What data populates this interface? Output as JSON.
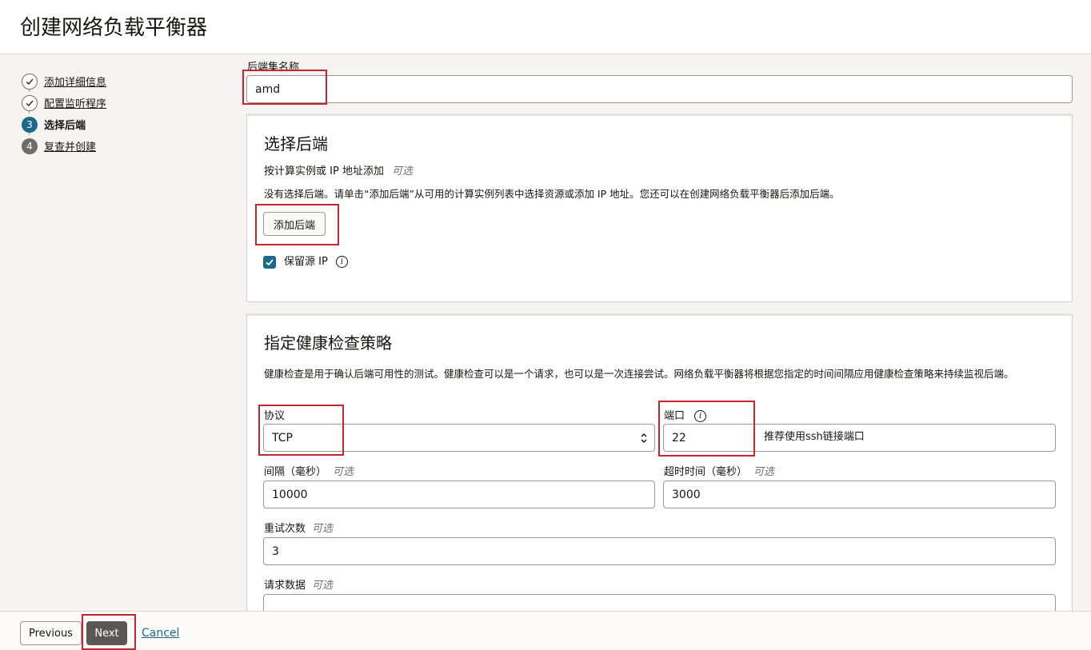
{
  "page": {
    "title": "创建网络负载平衡器"
  },
  "steps": [
    {
      "num": "1",
      "label": "添加详细信息",
      "state": "done"
    },
    {
      "num": "2",
      "label": "配置监听程序",
      "state": "done"
    },
    {
      "num": "3",
      "label": "选择后端",
      "state": "current"
    },
    {
      "num": "4",
      "label": "复查并创建",
      "state": "todo"
    }
  ],
  "backend_set": {
    "label": "后端集名称",
    "value": "amd"
  },
  "select_backends": {
    "title": "选择后端",
    "add_by_label": "按计算实例或 IP 地址添加",
    "optional": "可选",
    "empty_message": "没有选择后端。请单击“添加后端”从可用的计算实例列表中选择资源或添加 IP 地址。您还可以在创建网络负载平衡器后添加后端。",
    "add_button": "添加后端",
    "preserve_source_ip": {
      "label": "保留源 IP",
      "checked": true
    }
  },
  "health_check": {
    "title": "指定健康检查策略",
    "description": "健康检查是用于确认后端可用性的测试。健康检查可以是一个请求，也可以是一次连接尝试。网络负载平衡器将根据您指定的时间间隔应用健康检查策略来持续监视后端。",
    "protocol": {
      "label": "协议",
      "value": "TCP"
    },
    "port": {
      "label": "端口",
      "value": "22",
      "note": "推荐使用ssh链接端口"
    },
    "interval": {
      "label": "间隔（毫秒）",
      "optional": "可选",
      "value": "10000"
    },
    "timeout": {
      "label": "超时时间（毫秒）",
      "optional": "可选",
      "value": "3000"
    },
    "retries": {
      "label": "重试次数",
      "optional": "可选",
      "value": "3"
    },
    "request_data": {
      "label": "请求数据",
      "optional": "可选",
      "value": ""
    }
  },
  "footer": {
    "previous": "Previous",
    "next": "Next",
    "cancel": "Cancel"
  },
  "colors": {
    "accent": "#1b6a8b",
    "annotation": "#c1272d",
    "primary_button": "#5a5754"
  }
}
